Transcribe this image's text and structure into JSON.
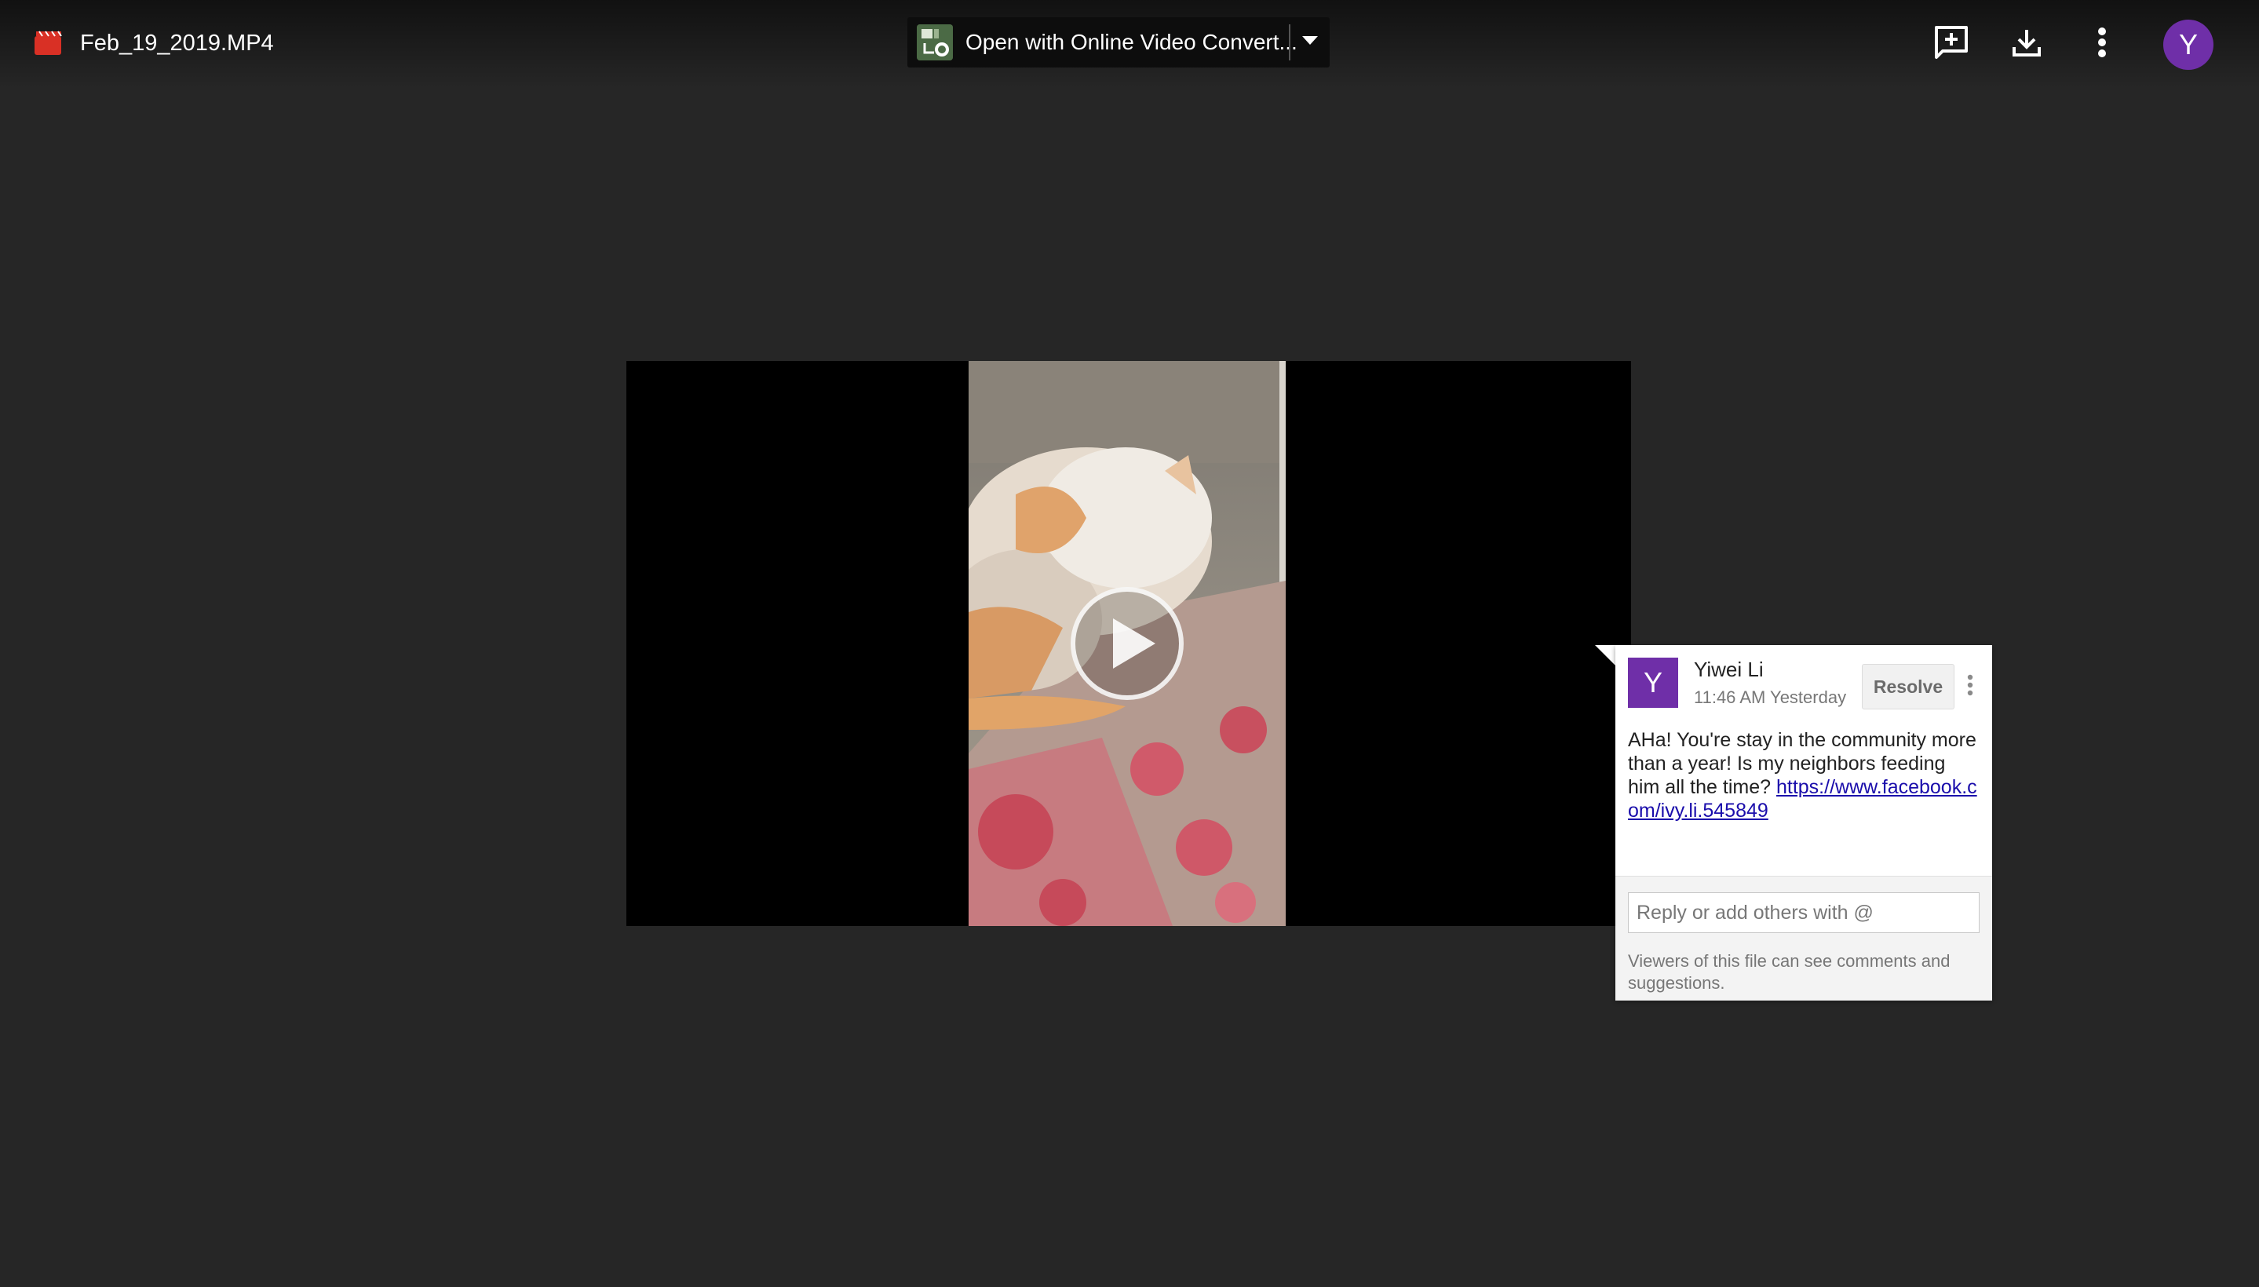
{
  "header": {
    "file_name": "Feb_19_2019.MP4",
    "file_icon": "video-file-icon",
    "open_with_label": "Open with Online Video Convert...",
    "open_with_app_icon": "online-video-converter-icon",
    "actions": [
      {
        "name": "add-comment",
        "icon": "add-comment-icon"
      },
      {
        "name": "download",
        "icon": "download-icon"
      },
      {
        "name": "more-options",
        "icon": "more-vertical-icon"
      }
    ],
    "user_avatar_initial": "Y"
  },
  "player": {
    "play_icon": "play-icon"
  },
  "comment": {
    "avatar_initial": "Y",
    "author": "Yiwei Li",
    "time": "11:46 AM Yesterday",
    "resolve_label": "Resolve",
    "body": "AHa! You're stay in the community more than a year! Is my neighbors feeding him all the time?",
    "link": "https://www.facebook.com/ivy.li.545849",
    "reply_placeholder": "Reply or add others with @",
    "viewers_note": "Viewers of this file can see comments and suggestions."
  },
  "colors": {
    "background": "#262626",
    "avatar": "#6f2fa8",
    "link": "#1a0dab"
  }
}
